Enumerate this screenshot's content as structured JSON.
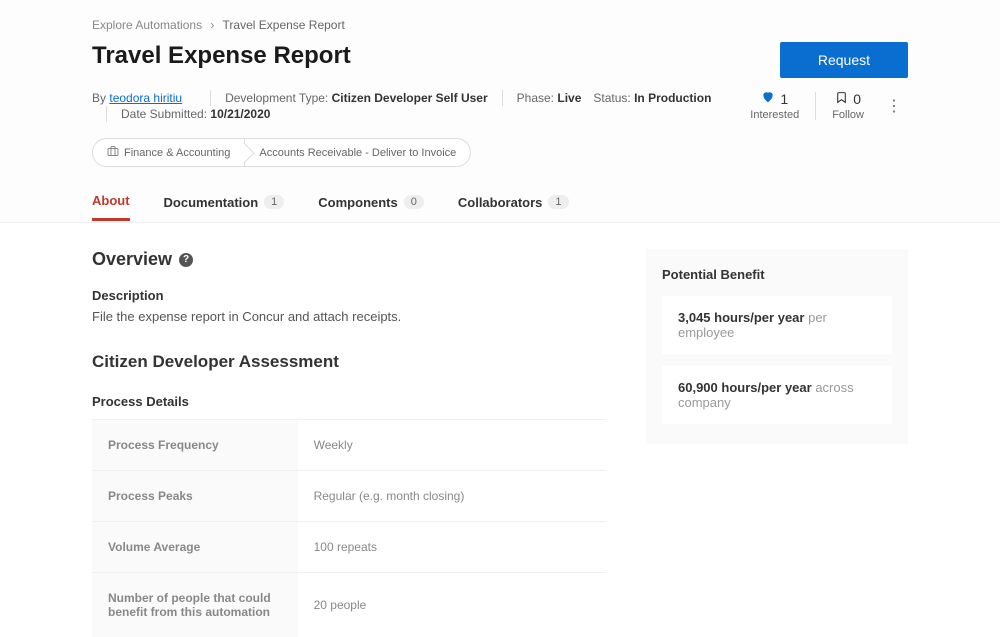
{
  "breadcrumb": {
    "root": "Explore Automations",
    "current": "Travel Expense Report"
  },
  "title": "Travel Expense Report",
  "request_button": "Request",
  "meta": {
    "by_label": "By",
    "author": "teodora hiritiu",
    "dev_type_label": "Development Type:",
    "dev_type": "Citizen Developer Self User",
    "phase_label": "Phase:",
    "phase": "Live",
    "status_label": "Status:",
    "status": "In Production",
    "date_label": "Date Submitted:",
    "date": "10/21/2020"
  },
  "actions": {
    "interested_count": "1",
    "interested_label": "Interested",
    "follow_count": "0",
    "follow_label": "Follow"
  },
  "tags": {
    "primary": "Finance & Accounting",
    "secondary": "Accounts Receivable - Deliver to Invoice"
  },
  "tabs": [
    {
      "label": "About",
      "badge": null,
      "active": true
    },
    {
      "label": "Documentation",
      "badge": "1",
      "active": false
    },
    {
      "label": "Components",
      "badge": "0",
      "active": false
    },
    {
      "label": "Collaborators",
      "badge": "1",
      "active": false
    }
  ],
  "overview": {
    "heading": "Overview",
    "description_label": "Description",
    "description": "File the expense report in Concur and attach receipts."
  },
  "assessment": {
    "heading": "Citizen Developer Assessment",
    "details_label": "Process Details",
    "rows": [
      {
        "key": "Process Frequency",
        "val": "Weekly"
      },
      {
        "key": "Process Peaks",
        "val": "Regular (e.g. month closing)"
      },
      {
        "key": "Volume Average",
        "val": "100 repeats"
      },
      {
        "key": "Number of people that could benefit from this automation",
        "val": "20 people"
      }
    ]
  },
  "benefit": {
    "title": "Potential Benefit",
    "row1_value": "3,045 hours/per year",
    "row1_suffix": "per employee",
    "row2_value": "60,900 hours/per year",
    "row2_suffix": "across company"
  }
}
